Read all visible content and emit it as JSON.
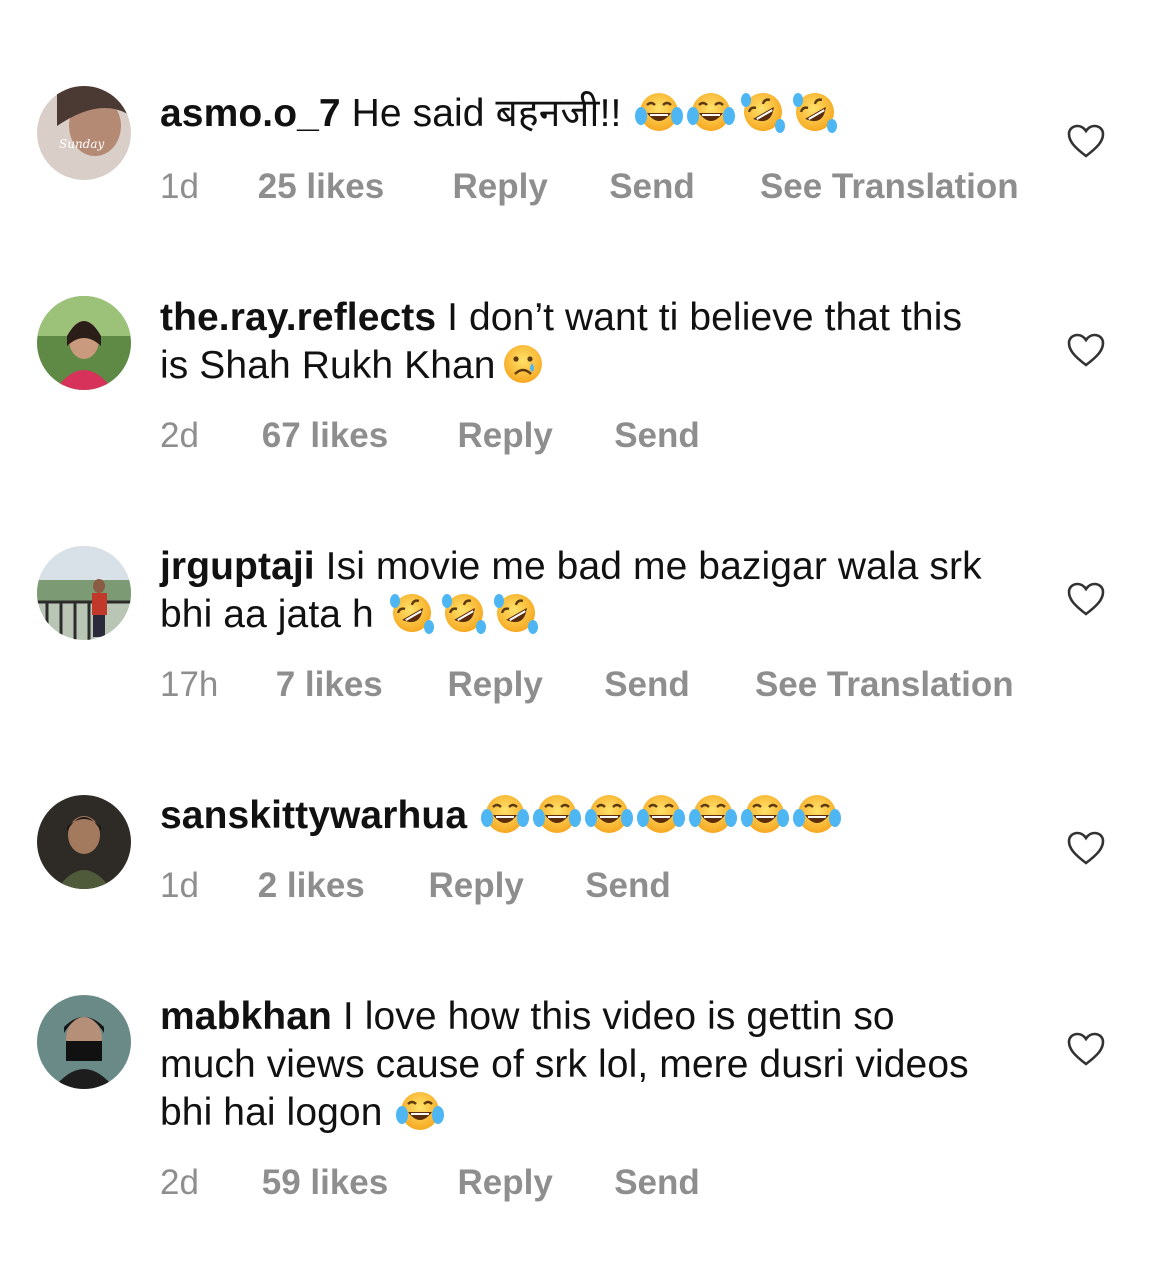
{
  "comments": [
    {
      "username": "asmo.o_7",
      "text": "He said बहनजी!!",
      "emojis": [
        "joy",
        "joy",
        "rofl",
        "rofl"
      ],
      "time": "1d",
      "likes": "25 likes",
      "reply": "Reply",
      "send": "Send",
      "translate": "See Translation",
      "avatar": "avatar-pale"
    },
    {
      "username": "the.ray.reflects",
      "text": "I don’t want ti believe that this is Shah Rukh Khan",
      "emojis": [
        "sad-tear"
      ],
      "time": "2d",
      "likes": "67 likes",
      "reply": "Reply",
      "send": "Send",
      "translate": "",
      "avatar": "avatar-green"
    },
    {
      "username": "jrguptaji",
      "text": "Isi movie me bad me bazigar wala srk bhi aa jata h",
      "emojis": [
        "rofl",
        "rofl",
        "rofl"
      ],
      "time": "17h",
      "likes": "7 likes",
      "reply": "Reply",
      "send": "Send",
      "translate": "See Translation",
      "avatar": "avatar-balcony"
    },
    {
      "username": "sanskittywarhua",
      "text": "",
      "emojis": [
        "joy",
        "joy",
        "joy",
        "joy",
        "joy",
        "joy",
        "joy"
      ],
      "time": "1d",
      "likes": "2 likes",
      "reply": "Reply",
      "send": "Send",
      "translate": "",
      "avatar": "avatar-dark"
    },
    {
      "username": "mabkhan",
      "text": "I love how this video is gettin so much views cause of srk lol, mere dusri videos bhi hai logon",
      "emojis": [
        "joy"
      ],
      "time": "2d",
      "likes": "59 likes",
      "reply": "Reply",
      "send": "Send",
      "translate": "",
      "avatar": "avatar-mask"
    }
  ],
  "icons": {
    "like": "heart-outline-icon"
  },
  "colors": {
    "text": "#111111",
    "meta": "#8e8e8e",
    "background": "#ffffff"
  }
}
